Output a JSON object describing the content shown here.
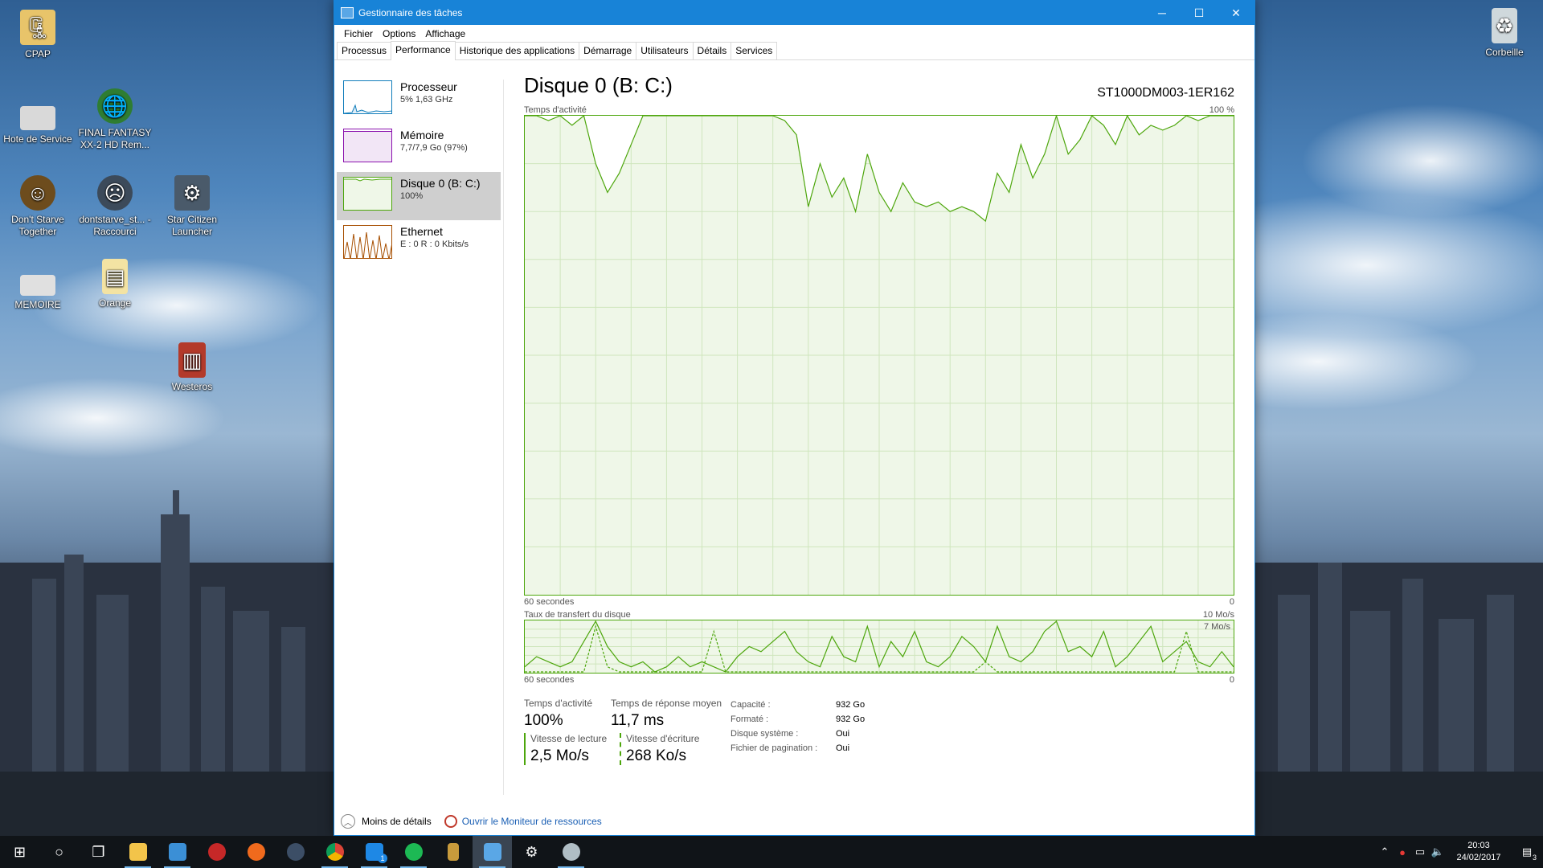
{
  "window": {
    "title": "Gestionnaire des tâches",
    "minimize_glyph": "─",
    "maximize_glyph": "☐",
    "close_glyph": "✕"
  },
  "menu": [
    "Fichier",
    "Options",
    "Affichage"
  ],
  "tabs": [
    "Processus",
    "Performance",
    "Historique des applications",
    "Démarrage",
    "Utilisateurs",
    "Détails",
    "Services"
  ],
  "active_tab": "Performance",
  "sidebar": {
    "items": [
      {
        "name": "Processeur",
        "sub": "5% 1,63 GHz",
        "color": "#117dbb"
      },
      {
        "name": "Mémoire",
        "sub": "7,7/7,9 Go (97%)",
        "color": "#8b12ae"
      },
      {
        "name": "Disque 0 (B: C:)",
        "sub": "100%",
        "color": "#4da60c"
      },
      {
        "name": "Ethernet",
        "sub": "E : 0 R : 0 Kbits/s",
        "color": "#a74f01"
      }
    ]
  },
  "main": {
    "title": "Disque 0 (B: C:)",
    "model": "ST1000DM003-1ER162",
    "activity_chart": {
      "label": "Temps d'activité",
      "max_label": "100 %",
      "x_left": "60 secondes",
      "x_right": "0"
    },
    "transfer_chart": {
      "label": "Taux de transfert du disque",
      "max_label": "10 Mo/s",
      "inner_label": "7 Mo/s",
      "x_left": "60 secondes",
      "x_right": "0"
    },
    "stats": {
      "activity_label": "Temps d'activité",
      "activity_value": "100%",
      "response_label": "Temps de réponse moyen",
      "response_value": "11,7 ms",
      "read_label": "Vitesse de lecture",
      "read_value": "2,5 Mo/s",
      "write_label": "Vitesse d'écriture",
      "write_value": "268 Ko/s"
    },
    "props": [
      {
        "k": "Capacité :",
        "v": "932 Go"
      },
      {
        "k": "Formaté :",
        "v": "932 Go"
      },
      {
        "k": "Disque système :",
        "v": "Oui"
      },
      {
        "k": "Fichier de pagination :",
        "v": "Oui"
      }
    ]
  },
  "footer": {
    "less_details": "Moins de détails",
    "open_monitor": "Ouvrir le Moniteur de ressources"
  },
  "chart_data": [
    {
      "type": "area",
      "title": "Temps d'activité",
      "ylim": [
        0,
        100
      ],
      "xlabel": "60 secondes",
      "x": [
        60,
        59,
        58,
        57,
        56,
        55,
        54,
        53,
        52,
        51,
        50,
        49,
        48,
        47,
        46,
        45,
        44,
        43,
        42,
        41,
        40,
        39,
        38,
        37,
        36,
        35,
        34,
        33,
        32,
        31,
        30,
        29,
        28,
        27,
        26,
        25,
        24,
        23,
        22,
        21,
        20,
        19,
        18,
        17,
        16,
        15,
        14,
        13,
        12,
        11,
        10,
        9,
        8,
        7,
        6,
        5,
        4,
        3,
        2,
        1,
        0
      ],
      "values": [
        100,
        100,
        99,
        100,
        98,
        100,
        90,
        84,
        88,
        94,
        100,
        100,
        100,
        100,
        100,
        100,
        100,
        100,
        100,
        100,
        100,
        100,
        99,
        96,
        81,
        90,
        83,
        87,
        80,
        92,
        84,
        80,
        86,
        82,
        81,
        82,
        80,
        81,
        80,
        78,
        88,
        84,
        94,
        87,
        92,
        100,
        92,
        95,
        100,
        98,
        94,
        100,
        96,
        98,
        97,
        98,
        100,
        99,
        100,
        100,
        100
      ],
      "grid": true
    },
    {
      "type": "line",
      "title": "Taux de transfert du disque",
      "ylim": [
        0,
        10
      ],
      "xlabel": "60 secondes",
      "x": [
        60,
        59,
        58,
        57,
        56,
        55,
        54,
        53,
        52,
        51,
        50,
        49,
        48,
        47,
        46,
        45,
        44,
        43,
        42,
        41,
        40,
        39,
        38,
        37,
        36,
        35,
        34,
        33,
        32,
        31,
        30,
        29,
        28,
        27,
        26,
        25,
        24,
        23,
        22,
        21,
        20,
        19,
        18,
        17,
        16,
        15,
        14,
        13,
        12,
        11,
        10,
        9,
        8,
        7,
        6,
        5,
        4,
        3,
        2,
        1,
        0
      ],
      "series": [
        {
          "values": [
            1,
            3,
            2,
            1,
            2,
            6,
            10,
            5,
            2,
            1,
            2,
            0,
            1,
            3,
            1,
            2,
            1,
            0,
            3,
            5,
            4,
            6,
            8,
            4,
            2,
            1,
            7,
            3,
            2,
            9,
            1,
            6,
            3,
            8,
            2,
            1,
            3,
            7,
            5,
            2,
            9,
            3,
            2,
            4,
            8,
            10,
            4,
            5,
            3,
            8,
            1,
            3,
            6,
            9,
            2,
            4,
            6,
            2,
            1,
            4,
            1
          ]
        },
        {
          "values": [
            0,
            0,
            0,
            0,
            0,
            0,
            9,
            1,
            0,
            0,
            0,
            0,
            0,
            0,
            0,
            0,
            8,
            0,
            0,
            0,
            0,
            0,
            0,
            0,
            0,
            0,
            0,
            0,
            0,
            0,
            0,
            0,
            0,
            0,
            0,
            0,
            0,
            0,
            0,
            2,
            0,
            0,
            0,
            0,
            0,
            0,
            0,
            0,
            0,
            0,
            0,
            0,
            0,
            0,
            0,
            0,
            8,
            0,
            0,
            0,
            0
          ]
        }
      ],
      "grid": true
    }
  ],
  "desktop": {
    "icons": [
      {
        "label": "CPAP",
        "icon": "folder-zip-icon",
        "color": "#e8c46a"
      },
      {
        "label": "Hote de Service",
        "icon": "drive-icon",
        "color": "#d9d9d9"
      },
      {
        "label": "FINAL FANTASY XX-2 HD Rem...",
        "icon": "globe-icon",
        "color": "#2e7d32"
      },
      {
        "label": "Don't Starve Together",
        "icon": "game-icon",
        "color": "#6d4c1d"
      },
      {
        "label": "dontstarve_st... - Raccourci",
        "icon": "game-icon",
        "color": "#3c4a5a"
      },
      {
        "label": "Star Citizen Launcher",
        "icon": "launcher-icon",
        "color": "#4a5a6a"
      },
      {
        "label": "MEMOIRE",
        "icon": "drive-icon",
        "color": "#e0e0e0"
      },
      {
        "label": "Orange",
        "icon": "document-icon",
        "color": "#f3e3a3"
      },
      {
        "label": "Westeros",
        "icon": "archive-icon",
        "color": "#b33a2a"
      },
      {
        "label": "Corbeille",
        "icon": "recycle-bin-icon",
        "color": "#cfd8dc"
      }
    ]
  },
  "taskbar": {
    "start_glyph": "⊞",
    "search_glyph": "○",
    "taskview_glyph": "❐",
    "time": "20:03",
    "date": "24/02/2017",
    "notification_count": "3",
    "camera_badge": "1"
  },
  "colors": {
    "accent": "#1883d7",
    "disk_green": "#4da60c",
    "cpu_blue": "#117dbb",
    "mem_purple": "#8b12ae",
    "eth_orange": "#a74f01"
  }
}
